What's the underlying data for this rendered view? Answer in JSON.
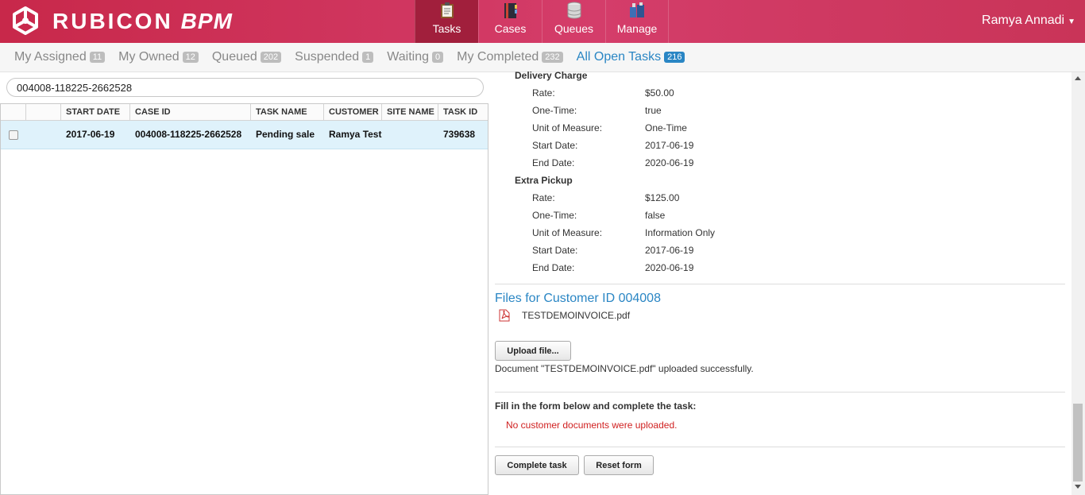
{
  "header": {
    "logo_brand": "RUBICON",
    "logo_product": "BPM",
    "nav": [
      {
        "label": "Tasks",
        "icon": "clipboard-icon",
        "active": true
      },
      {
        "label": "Cases",
        "icon": "binder-icon"
      },
      {
        "label": "Queues",
        "icon": "database-icon"
      },
      {
        "label": "Manage",
        "icon": "manage-icon"
      }
    ],
    "user": "Ramya Annadi"
  },
  "tabs": [
    {
      "label": "My Assigned",
      "count": "11"
    },
    {
      "label": "My Owned",
      "count": "12"
    },
    {
      "label": "Queued",
      "count": "202"
    },
    {
      "label": "Suspended",
      "count": "1"
    },
    {
      "label": "Waiting",
      "count": "0"
    },
    {
      "label": "My Completed",
      "count": "232"
    },
    {
      "label": "All Open Tasks",
      "count": "216",
      "active": true
    }
  ],
  "search": {
    "value": "004008-118225-2662528"
  },
  "grid": {
    "columns": [
      "START DATE",
      "CASE ID",
      "TASK NAME",
      "CUSTOMER",
      "SITE NAME",
      "TASK ID"
    ],
    "rows": [
      {
        "start_date": "2017-06-19",
        "case_id": "004008-118225-2662528",
        "task_name": "Pending sale",
        "customer": "Ramya Test",
        "site_name": "",
        "task_id": "739638"
      }
    ]
  },
  "detail": {
    "charges": [
      {
        "name": "Delivery Charge",
        "fields": [
          {
            "label": "Rate:",
            "value": "$50.00"
          },
          {
            "label": "One-Time:",
            "value": "true"
          },
          {
            "label": "Unit of Measure:",
            "value": "One-Time"
          },
          {
            "label": "Start Date:",
            "value": "2017-06-19"
          },
          {
            "label": "End Date:",
            "value": "2020-06-19"
          }
        ]
      },
      {
        "name": "Extra Pickup",
        "fields": [
          {
            "label": "Rate:",
            "value": "$125.00"
          },
          {
            "label": "One-Time:",
            "value": "false"
          },
          {
            "label": "Unit of Measure:",
            "value": "Information Only"
          },
          {
            "label": "Start Date:",
            "value": "2017-06-19"
          },
          {
            "label": "End Date:",
            "value": "2020-06-19"
          }
        ]
      }
    ],
    "files_title": "Files for Customer ID 004008",
    "file_name": "TESTDEMOINVOICE.pdf",
    "upload_label": "Upload file...",
    "upload_message": "Document \"TESTDEMOINVOICE.pdf\" uploaded successfully.",
    "form_label": "Fill in the form below and complete the task:",
    "error_message": "No customer documents were uploaded.",
    "complete_label": "Complete task",
    "reset_label": "Reset form"
  },
  "colors": {
    "brand": "#c8284a",
    "accent": "#2a86c4",
    "error": "#d02020",
    "selected_row": "#dff2fb"
  }
}
